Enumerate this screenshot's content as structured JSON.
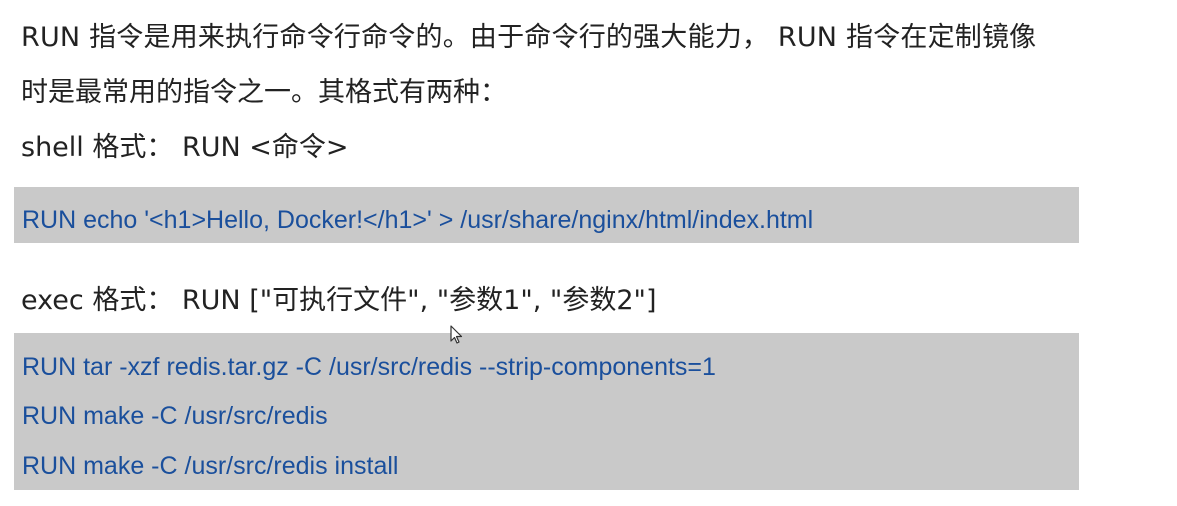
{
  "paragraph": {
    "line1": "RUN 指令是用来执行命令行命令的。由于命令行的强大能力， RUN 指令在定制镜像",
    "line2": "时是最常用的指令之一。其格式有两种："
  },
  "shell_format": {
    "label": "shell 格式： RUN <命令>",
    "code": [
      "RUN echo '<h1>Hello, Docker!</h1>' > /usr/share/nginx/html/index.html"
    ]
  },
  "exec_format": {
    "label": "exec 格式： RUN [\"可执行文件\", \"参数1\", \"参数2\"]",
    "code": [
      "RUN tar -xzf redis.tar.gz -C /usr/src/redis --strip-components=1",
      "RUN make -C /usr/src/redis",
      "RUN make -C /usr/src/redis install"
    ]
  },
  "colors": {
    "code_text": "#1a4f9c",
    "code_background": "#c9c9c9",
    "body_text": "#222222"
  },
  "icons": {
    "cursor": "mouse-pointer-icon"
  }
}
